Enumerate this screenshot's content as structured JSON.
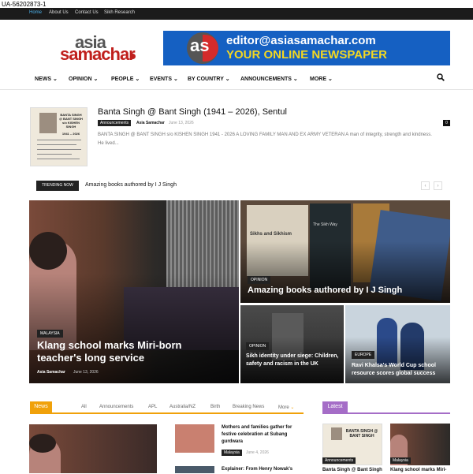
{
  "page_id": "UA-56202873-1",
  "topbar": {
    "links": [
      "Home",
      "About Us",
      "Contact Us",
      "Sikh Research"
    ],
    "active": "Home"
  },
  "logo": {
    "line1": "asia",
    "line2": "samachar"
  },
  "banner": {
    "badge": "as",
    "email": "editor@asiasamachar.com",
    "tagline": "YOUR ONLINE NEWSPAPER"
  },
  "nav": {
    "items": [
      "NEWS",
      "OPINION",
      "PEOPLE",
      "EVENTS",
      "BY COUNTRY",
      "ANNOUNCEMENTS",
      "MORE"
    ],
    "search_icon": "search-icon"
  },
  "featured": {
    "title": "Banta Singh @ Bant Singh (1941 – 2026), Sentul",
    "category": "Announcements",
    "author": "Asia Samachar",
    "date": "June 13, 2026",
    "comments": "0",
    "excerpt": "BANTA SINGH @ BANT SINGH s/o KISHEN SINGH 1941 - 2026 A LOVING FAMILY MAN AND EX ARMY VETERAN A man of integrity, strength and kindness. He lived...",
    "card_text": "BANTA SINGH @ BANT SINGH s/o KISHEN SINGH",
    "card_years": "1941 – 2026"
  },
  "trending": {
    "label": "TRENDING NOW",
    "text": "Amazing books authored by I J Singh",
    "prev": "‹",
    "next": "›"
  },
  "grid": {
    "main": {
      "category": "MALAYSIA",
      "title": "Klang school marks Miri-born teacher's long service",
      "author": "Asia Samachar",
      "date": "June 13, 2026"
    },
    "top_right": {
      "category": "OPINION",
      "title": "Amazing books authored by I J Singh",
      "book1": "Sikhs and Sikhism",
      "book2": "The Sikh Way"
    },
    "bottom_left": {
      "category": "OPINION",
      "title": "Sikh identity under siege: Children, safety and racism in the UK"
    },
    "bottom_right": {
      "category": "EUROPE",
      "title": "Ravi Khalsa's World Cup school resource scores global success"
    }
  },
  "news_section": {
    "label": "News",
    "filters": [
      "All",
      "Announcements",
      "APL",
      "Australia/NZ",
      "Birth",
      "Breaking News",
      "More"
    ],
    "items": [
      {
        "title": "Mothers and families gather for festive celebration at Subang gurdwara",
        "category": "Malaysia",
        "date": "June 4, 2026"
      },
      {
        "title": "Explainer: From Henry Nowak's"
      }
    ]
  },
  "latest_section": {
    "label": "Latest",
    "items": [
      {
        "category": "Announcements",
        "title": "Banta Singh @ Bant Singh",
        "card_text": "BANTA SINGH @ BANT SINGH"
      },
      {
        "category": "Malaysia",
        "title": "Klang school marks Miri-"
      }
    ]
  },
  "colors": {
    "brand_red": "#c0201d",
    "banner_blue": "#1560c2",
    "banner_yellow": "#f4d821",
    "news_orange": "#f0a10a",
    "latest_purple": "#a56dc7"
  }
}
